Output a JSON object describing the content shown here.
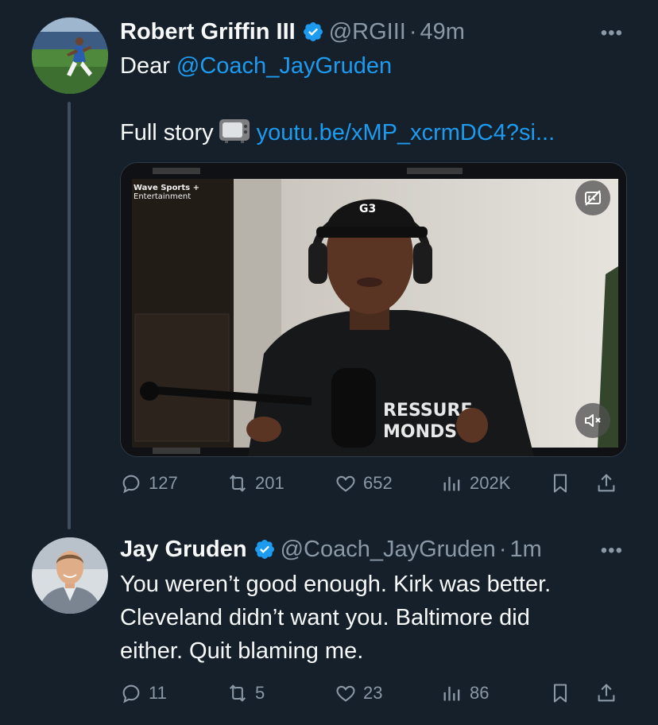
{
  "tweet1": {
    "name": "Robert Griffin III",
    "handle": "@RGIII",
    "dot": "·",
    "time": "49m",
    "text_prefix": "Dear ",
    "mention": "@Coach_JayGruden",
    "text2": "Full story",
    "link": "youtu.be/xMP_xcrmDC4?si...",
    "media": {
      "watermark_line1": "Wave Sports +",
      "watermark_line2": "Entertainment",
      "hat_logo": "G3",
      "hoodie_text_1": "RESSURE",
      "hoodie_text_2": "MONDS"
    },
    "stats": {
      "replies": "127",
      "reposts": "201",
      "likes": "652",
      "views": "202K"
    }
  },
  "tweet2": {
    "name": "Jay Gruden",
    "handle": "@Coach_JayGruden",
    "dot": "·",
    "time": "1m",
    "line1": "You weren’t good enough.  Kirk was better.",
    "line2": "Cleveland didn’t want you.  Baltimore did",
    "line3": "either.  Quit blaming me.",
    "stats": {
      "replies": "11",
      "reposts": "5",
      "likes": "23",
      "views": "86"
    }
  },
  "more_label": "•••",
  "colors": {
    "background": "#15202b",
    "link": "#1d9bf0",
    "muted": "#8b98a5",
    "text": "#f7f9f9"
  }
}
